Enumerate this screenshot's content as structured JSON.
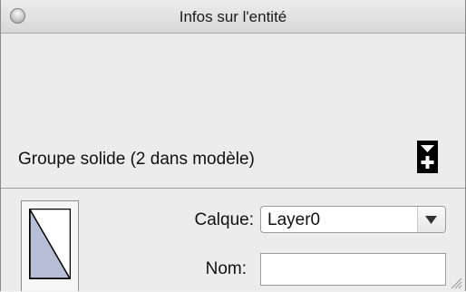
{
  "window": {
    "title": "Infos sur l'entité"
  },
  "entity": {
    "type_label": "Groupe solide (2 dans modèle)"
  },
  "fields": {
    "layer_label": "Calque:",
    "layer_value": "Layer0",
    "name_label": "Nom:",
    "name_value": ""
  },
  "icons": {
    "close": "close-circle",
    "toggle": "expand-details-icon",
    "dropdown": "chevron-down-icon",
    "material": "material-swatch-icon",
    "resize": "resize-grip-icon"
  },
  "colors": {
    "swatch_fill": "#b7bed8",
    "panel_bg": "#ececec"
  }
}
